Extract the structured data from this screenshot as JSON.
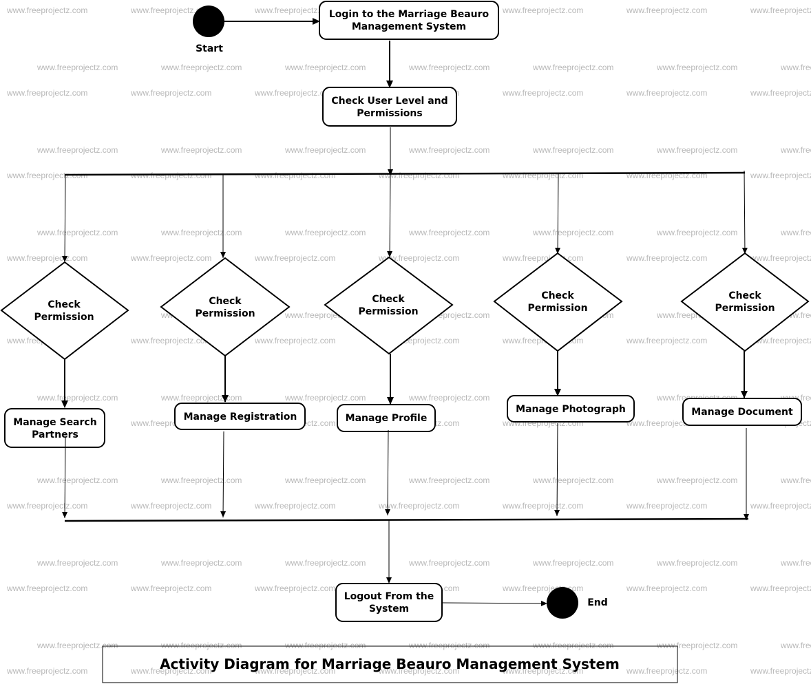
{
  "diagram": {
    "title": "Activity Diagram for Marriage Beauro Management System",
    "watermark": "www.freeprojectz.com",
    "start_label": "Start",
    "end_label": "End",
    "login": [
      "Login to the Marriage Beauro",
      "Management System"
    ],
    "check_user": [
      "Check User Level and",
      "Permissions"
    ],
    "decisions": [
      {
        "lines": [
          "Check",
          "Permission"
        ]
      },
      {
        "lines": [
          "Check",
          "Permission"
        ]
      },
      {
        "lines": [
          "Check",
          "Permission"
        ]
      },
      {
        "lines": [
          "Check",
          "Permission"
        ]
      },
      {
        "lines": [
          "Check",
          "Permission"
        ]
      }
    ],
    "activities": [
      {
        "lines": [
          "Manage Search",
          "Partners"
        ]
      },
      {
        "lines": [
          "Manage Registration"
        ]
      },
      {
        "lines": [
          "Manage Profile"
        ]
      },
      {
        "lines": [
          "Manage Photograph"
        ]
      },
      {
        "lines": [
          "Manage Document"
        ]
      }
    ],
    "logout": [
      "Logout From the",
      "System"
    ]
  }
}
